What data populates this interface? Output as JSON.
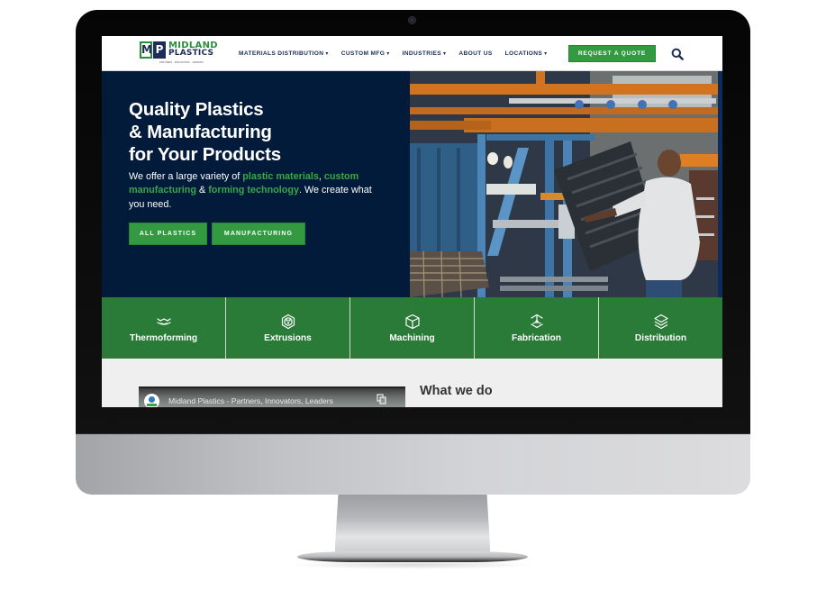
{
  "device": {
    "type": "desktop-monitor-mockup"
  },
  "header": {
    "logo": {
      "initials": [
        "M",
        "P"
      ],
      "name_line1": "MIDLAND",
      "name_line2": "PLASTICS",
      "tagline": "PARTNERS · INNOVATORS · LEADERS"
    },
    "nav": [
      {
        "label": "MATERIALS DISTRIBUTION",
        "has_dropdown": true
      },
      {
        "label": "CUSTOM MFG",
        "has_dropdown": true
      },
      {
        "label": "INDUSTRIES",
        "has_dropdown": true
      },
      {
        "label": "ABOUT US",
        "has_dropdown": false
      },
      {
        "label": "LOCATIONS",
        "has_dropdown": true
      }
    ],
    "dropdown_caret": "▾",
    "cta_label": "REQUEST A QUOTE",
    "search_icon": "search-icon"
  },
  "hero": {
    "title_lines": [
      "Quality Plastics",
      "& Manufacturing",
      "for Your Products"
    ],
    "text": {
      "part1": "We offer a large variety of ",
      "link1": "plastic materials",
      "part2": ", ",
      "link2": "custom manufacturing",
      "part3": " & ",
      "link3": "forming technology",
      "part4": ". We create what you need."
    },
    "buttons": [
      "ALL PLASTICS",
      "MANUFACTURING"
    ],
    "image_alt": "Worker lifting a thermoformed plastic panel in a factory"
  },
  "services": [
    {
      "label": "Thermoforming",
      "icon": "thermoforming-icon"
    },
    {
      "label": "Extrusions",
      "icon": "extrusions-icon"
    },
    {
      "label": "Machining",
      "icon": "machining-cube-icon"
    },
    {
      "label": "Fabrication",
      "icon": "fabrication-icon"
    },
    {
      "label": "Distribution",
      "icon": "distribution-layers-icon"
    }
  ],
  "lower": {
    "video_title": "Midland Plastics - Partners, Innovators, Leaders",
    "section_title": "What we do"
  },
  "colors": {
    "navy": "#021b3b",
    "brand_green": "#339a42",
    "services_green": "#2a7b38",
    "nav_text": "#1d2d55",
    "highlight_green": "#3aa64a"
  }
}
